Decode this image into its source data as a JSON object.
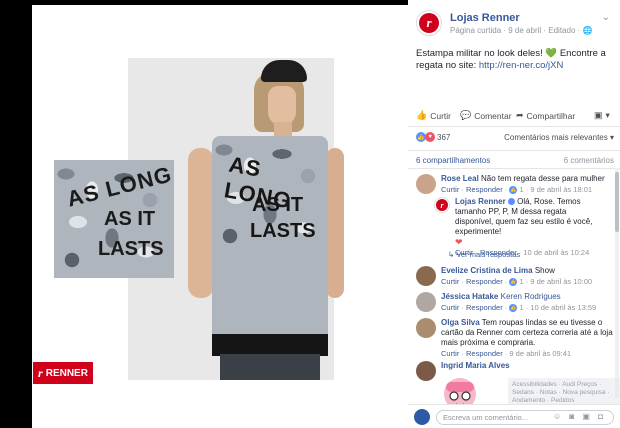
{
  "photo": {
    "inset_print": [
      "AS LONG",
      "AS IT",
      "LASTS"
    ],
    "shirt_print": [
      "AS LONG",
      "AS IT",
      "LASTS"
    ],
    "brand_badge": "RENNER"
  },
  "post": {
    "page_name": "Lojas Renner",
    "meta": "Página curtida · 9 de abril · Editado · ",
    "text": "Estampa militar no look deles! 💚 Encontre a regata no site: ",
    "link": "http://ren-ner.co/jXN"
  },
  "actions": {
    "like": "Curtir",
    "comment": "Comentar",
    "share": "Compartilhar"
  },
  "stats": {
    "reactions_count": "367",
    "sort_label": "Comentários mais relevantes ▾",
    "shares": "6 compartilhamentos",
    "comments": "6 comentários"
  },
  "comments": [
    {
      "name": "Rose Leal",
      "text": "Não tem regata desse para mulher",
      "like": "Curtir",
      "reply": "Responder",
      "likes": "1",
      "date": "9 de abril às 18:01",
      "avatar_color": "#c9a48a"
    },
    {
      "name": "Lojas Renner",
      "text": "Olá, Rose. Temos tamanho PP, P, M dessa regata disponível, quem faz seu estilo é você, experimente!",
      "emoji": "❤",
      "like": "Curtir",
      "reply": "Responder",
      "date": "10 de abril às 10:24"
    },
    {
      "name": "Evelize Cristina de Lima",
      "text": "Show",
      "like": "Curtir",
      "reply": "Responder",
      "likes": "1",
      "date": "9 de abril às 10:00",
      "avatar_color": "#8a6a4f"
    },
    {
      "name": "Jéssica Hatake",
      "text": "Keren Rodrigues",
      "like": "Curtir",
      "reply": "Responder",
      "likes": "1",
      "date": "10 de abril às 13:59",
      "avatar_color": "#b0a7a2"
    },
    {
      "name": "Olga Silva",
      "text": "Tem roupas lindas se eu tivesse o cartão da Renner com certeza correria até a loja mais próxima e compraria.",
      "like": "Curtir",
      "reply": "Responder",
      "date": "9 de abril às 09:41",
      "avatar_color": "#a98d6e"
    },
    {
      "name": "Ingrid Maria Alves",
      "text": "",
      "avatar_color": "#7b5b48"
    }
  ],
  "more_replies": "↳ Ver mais respostas",
  "notification_ghost": "Acessibilidades · Audi Preços · Sedans · Notas · Nova pesquisa · Andamento · Pedidos",
  "composer": {
    "placeholder": "Escreva um comentário...",
    "icons": "☺ ◙ ▣ ◘"
  },
  "colors": {
    "brand_red": "#d0021b",
    "link_blue": "#365899",
    "like_blue": "#5890ff"
  }
}
